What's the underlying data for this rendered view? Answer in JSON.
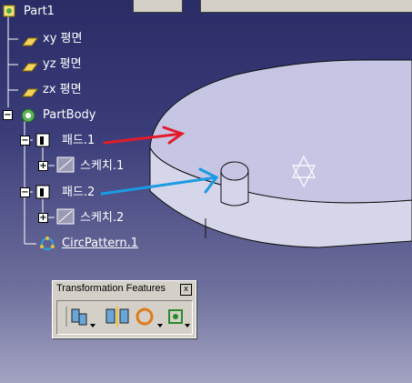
{
  "tree": {
    "root": "Part1",
    "planes": [
      "xy 평면",
      "yz 평면",
      "zx 평면"
    ],
    "body": "PartBody",
    "pad1": "패드.1",
    "sketch1": "스케치.1",
    "pad2": "패드.2",
    "sketch2": "스케치.2",
    "pattern": "CircPattern.1"
  },
  "toolbar": {
    "title": "Transformation Features",
    "close": "x",
    "buttons": [
      "translation-icon",
      "symmetry-icon",
      "circular-pattern-icon",
      "scale-icon"
    ]
  },
  "colors": {
    "arrow_red": "#e21b2a",
    "arrow_blue": "#1b9be2",
    "disk_top": "#c4c4e2",
    "disk_side": "#d8d8ec"
  }
}
